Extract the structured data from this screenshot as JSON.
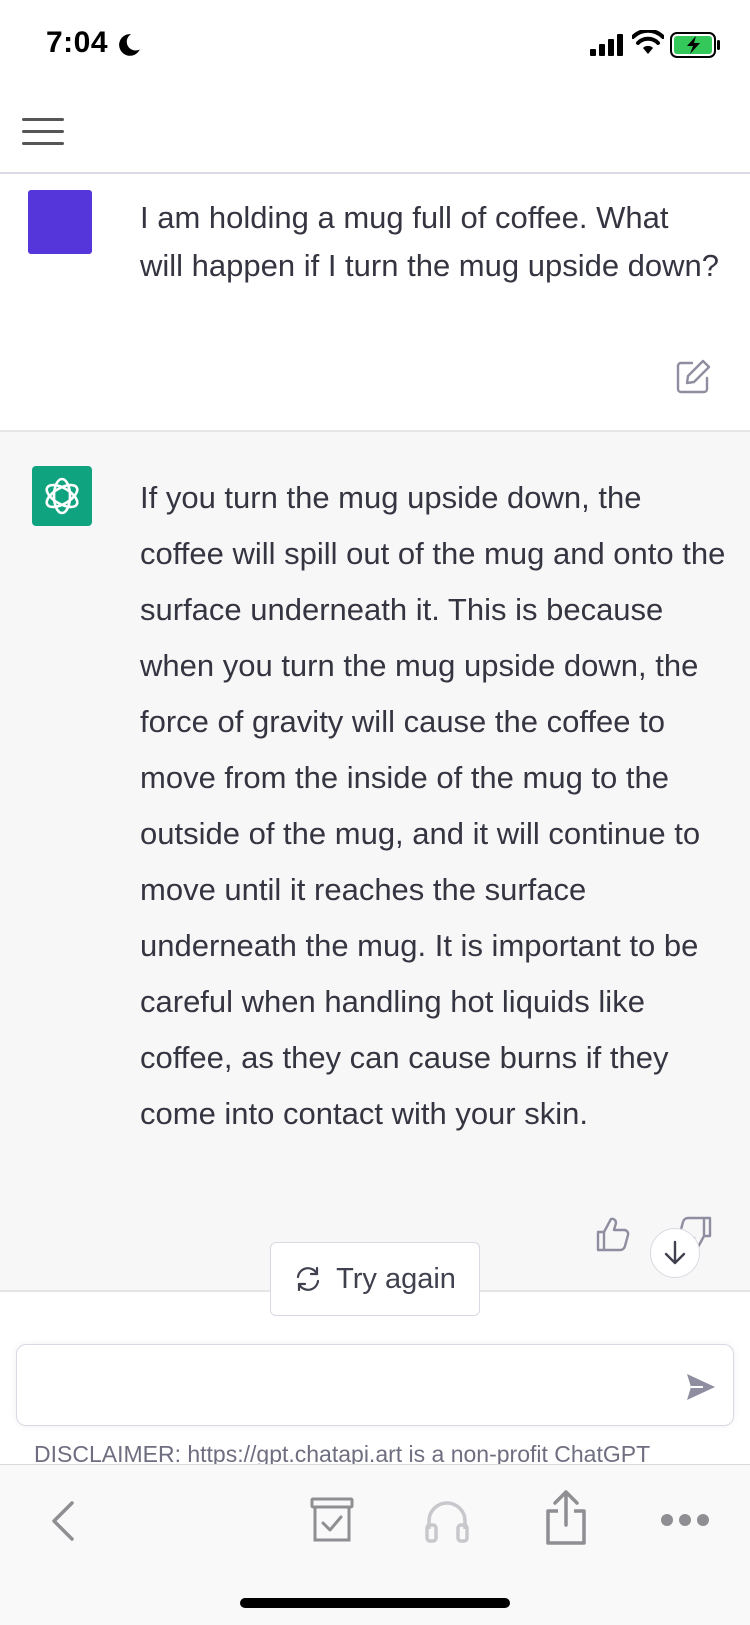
{
  "status_bar": {
    "time": "7:04"
  },
  "conversation": {
    "user_message": "I am holding a mug full of coffee. What will happen if I turn the mug upside down?",
    "assistant_message": "If you turn the mug upside down, the coffee will spill out of the mug and onto the surface underneath it. This is because when you turn the mug upside down, the force of gravity will cause the coffee to move from the inside of the mug to the outside of the mug, and it will continue to move until it reaches the surface underneath the mug. It is important to be careful when handling hot liquids like coffee, as they can cause burns if they come into contact with your skin."
  },
  "actions": {
    "try_again_label": "Try again"
  },
  "composer": {
    "value": "",
    "placeholder": ""
  },
  "disclaimer": "DISCLAIMER: https://gpt.chatapi.art is a non-profit ChatGPT",
  "colors": {
    "user_avatar": "#5436da",
    "assistant_avatar": "#10a37f",
    "assistant_bg": "#f7f7f8"
  },
  "icons": [
    "moon-icon",
    "signal-icon",
    "wifi-icon",
    "battery-icon",
    "menu-icon",
    "edit-icon",
    "openai-logo-icon",
    "thumbs-up-icon",
    "thumbs-down-icon",
    "arrow-down-icon",
    "refresh-icon",
    "send-icon",
    "back-icon",
    "archive-icon",
    "headphones-icon",
    "share-icon",
    "more-icon"
  ]
}
